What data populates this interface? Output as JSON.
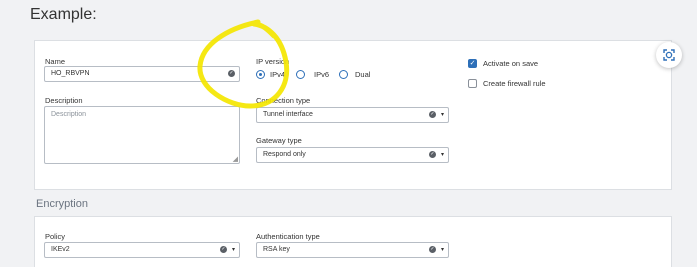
{
  "example_title": "Example:",
  "general": {
    "name": {
      "label": "Name",
      "value": "HO_RBVPN"
    },
    "description": {
      "label": "Description",
      "placeholder": "Description"
    },
    "ip_version": {
      "label": "IP version",
      "options": [
        {
          "label": "IPv4",
          "selected": true
        },
        {
          "label": "IPv6",
          "selected": false
        },
        {
          "label": "Dual",
          "selected": false
        }
      ]
    },
    "connection_type": {
      "label": "Connection type",
      "value": "Tunnel interface"
    },
    "gateway_type": {
      "label": "Gateway type",
      "value": "Respond only"
    },
    "activate_on_save": {
      "label": "Activate on save",
      "checked": true
    },
    "create_firewall_rule": {
      "label": "Create firewall rule",
      "checked": false
    }
  },
  "encryption": {
    "section_title": "Encryption",
    "policy": {
      "label": "Policy",
      "value": "IKEv2"
    },
    "authentication_type": {
      "label": "Authentication type",
      "value": "RSA key"
    }
  },
  "colors": {
    "accent": "#2d6fb8",
    "highlight": "#f4e600"
  },
  "icons": {
    "fab": "screenshot-scan-icon",
    "valid": "check-circle-icon",
    "dropdown": "caret-down-icon"
  }
}
